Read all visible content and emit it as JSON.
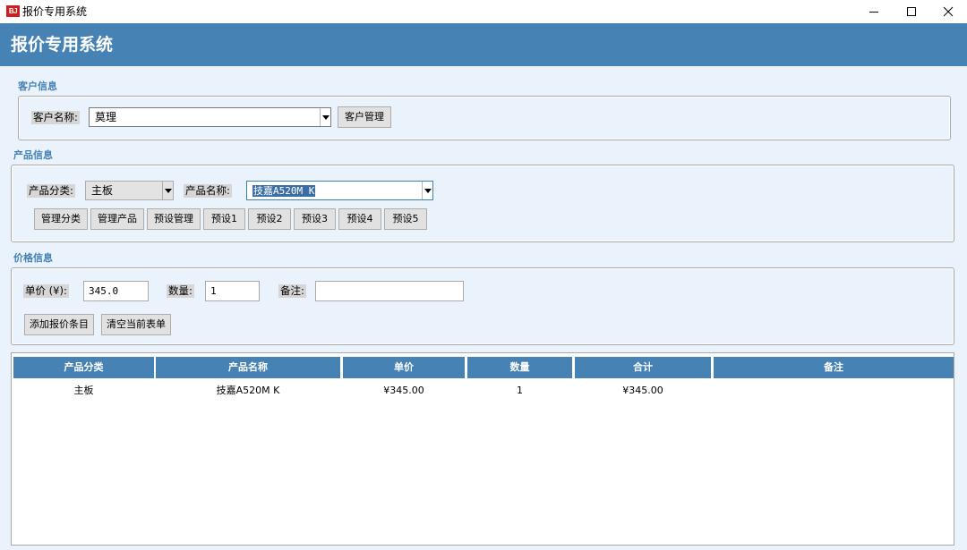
{
  "window": {
    "icon_text": "BJ",
    "title": "报价专用系统"
  },
  "banner": {
    "title": "报价专用系统"
  },
  "customer": {
    "section": "客户信息",
    "name_label": "客户名称:",
    "name_value": "莫理",
    "manage_button": "客户管理"
  },
  "product": {
    "section": "产品信息",
    "category_label": "产品分类:",
    "category_value": "主板",
    "name_label": "产品名称:",
    "name_value": "技嘉A520M K",
    "buttons": [
      "管理分类",
      "管理产品",
      "预设管理",
      "预设1",
      "预设2",
      "预设3",
      "预设4",
      "预设5"
    ]
  },
  "price": {
    "section": "价格信息",
    "unit_label": "单价 (¥):",
    "unit_value": "345.0",
    "qty_label": "数量:",
    "qty_value": "1",
    "note_label": "备注:",
    "note_value": "",
    "add_button": "添加报价条目",
    "clear_button": "清空当前表单"
  },
  "table": {
    "headers": [
      "产品分类",
      "产品名称",
      "单价",
      "数量",
      "合计",
      "备注"
    ],
    "rows": [
      [
        "主板",
        "技嘉A520M K",
        "¥345.00",
        "1",
        "¥345.00",
        ""
      ]
    ]
  },
  "colors": {
    "accent": "#4682b4",
    "background": "#eaf3fb"
  }
}
